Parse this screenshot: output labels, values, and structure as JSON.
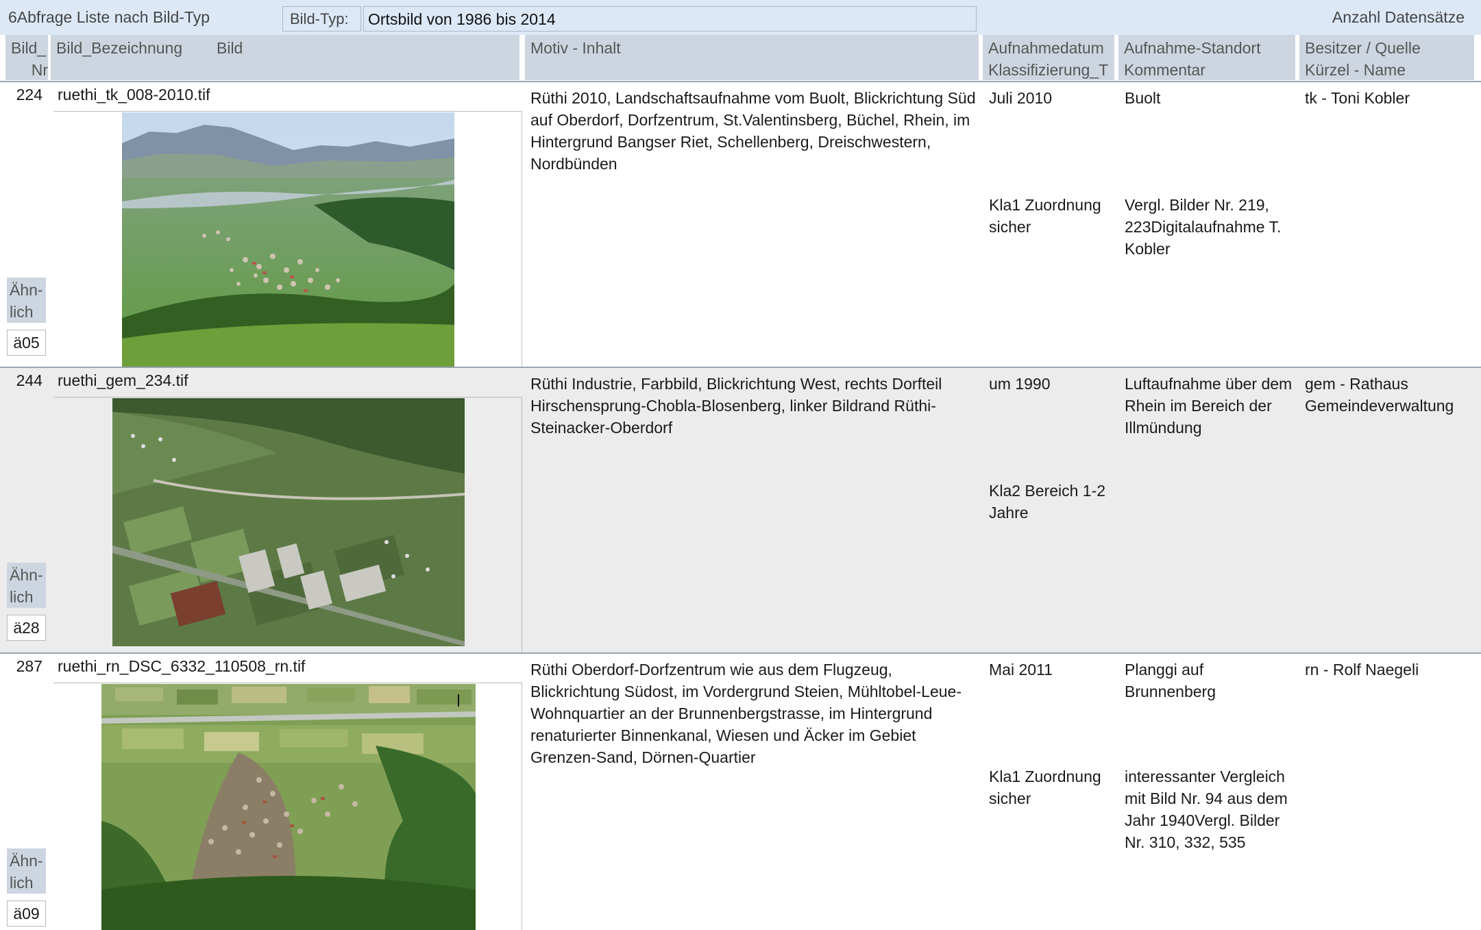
{
  "header": {
    "title": "6Abfrage Liste nach Bild-Typ",
    "bildtyp_label": "Bild-Typ:",
    "bildtyp_value": "Ortsbild von 1986 bis 2014",
    "count_label": "Anzahl Datensätze"
  },
  "columns": {
    "nr_line1": "Bild_",
    "nr_line2": "Nr",
    "bezeichnung": "Bild_Bezeichnung",
    "bild": "Bild",
    "motiv": "Motiv - Inhalt",
    "datum_line1": "Aufnahmedatum",
    "datum_line2": "Klassifizierung_T",
    "standort_line1": "Aufnahme-Standort",
    "standort_line2": "Kommentar",
    "besitzer_line1": "Besitzer / Quelle",
    "besitzer_line2": "Kürzel - Name"
  },
  "similar_label_line1": "Ähn-",
  "similar_label_line2": "lich",
  "records": [
    {
      "nr": "224",
      "name": "ruethi_tk_008-2010.tif",
      "motiv": "Rüthi 2010, Landschaftsaufnahme vom Buolt, Blickrichtung Süd auf Oberdorf, Dorfzentrum, St.Valentinsberg, Büchel, Rhein, im Hintergrund Bangser Riet, Schellenberg, Dreischwestern, Nordbünden",
      "datum": "Juli 2010",
      "klass": "Kla1 Zuordnung sicher",
      "standort": "Buolt",
      "kommentar": "Vergl. Bilder Nr. 219, 223Digitalaufnahme T. Kobler",
      "besitzer": "tk - Toni Kobler",
      "aehnlich": "ä05"
    },
    {
      "nr": "244",
      "name": "ruethi_gem_234.tif",
      "motiv": "Rüthi Industrie, Farbbild, Blickrichtung West, rechts Dorfteil Hirschensprung-Chobla-Blosenberg, linker Bildrand Rüthi-Steinacker-Oberdorf",
      "datum": "um 1990",
      "klass": "Kla2 Bereich 1-2 Jahre",
      "standort": "Luftaufnahme über dem Rhein im Bereich der Illmündung",
      "kommentar": "",
      "besitzer": "gem - Rathaus Gemeindeverwaltung",
      "aehnlich": "ä28"
    },
    {
      "nr": "287",
      "name": "ruethi_rn_DSC_6332_110508_rn.tif",
      "motiv": "Rüthi Oberdorf-Dorfzentrum wie aus dem Flugzeug, Blickrichtung Südost, im Vordergrund Steien, Mühltobel-Leue-Wohnquartier an der Brunnenbergstrasse, im Hintergrund renaturierter Binnenkanal, Wiesen und Äcker im Gebiet Grenzen-Sand, Dörnen-Quartier",
      "datum": "Mai 2011",
      "klass": "Kla1 Zuordnung sicher",
      "standort": "Planggi auf Brunnenberg",
      "kommentar": "interessanter Vergleich mit Bild Nr. 94 aus dem Jahr 1940Vergl. Bilder Nr. 310, 332, 535",
      "besitzer": "rn - Rolf Naegeli",
      "aehnlich": "ä09"
    }
  ]
}
